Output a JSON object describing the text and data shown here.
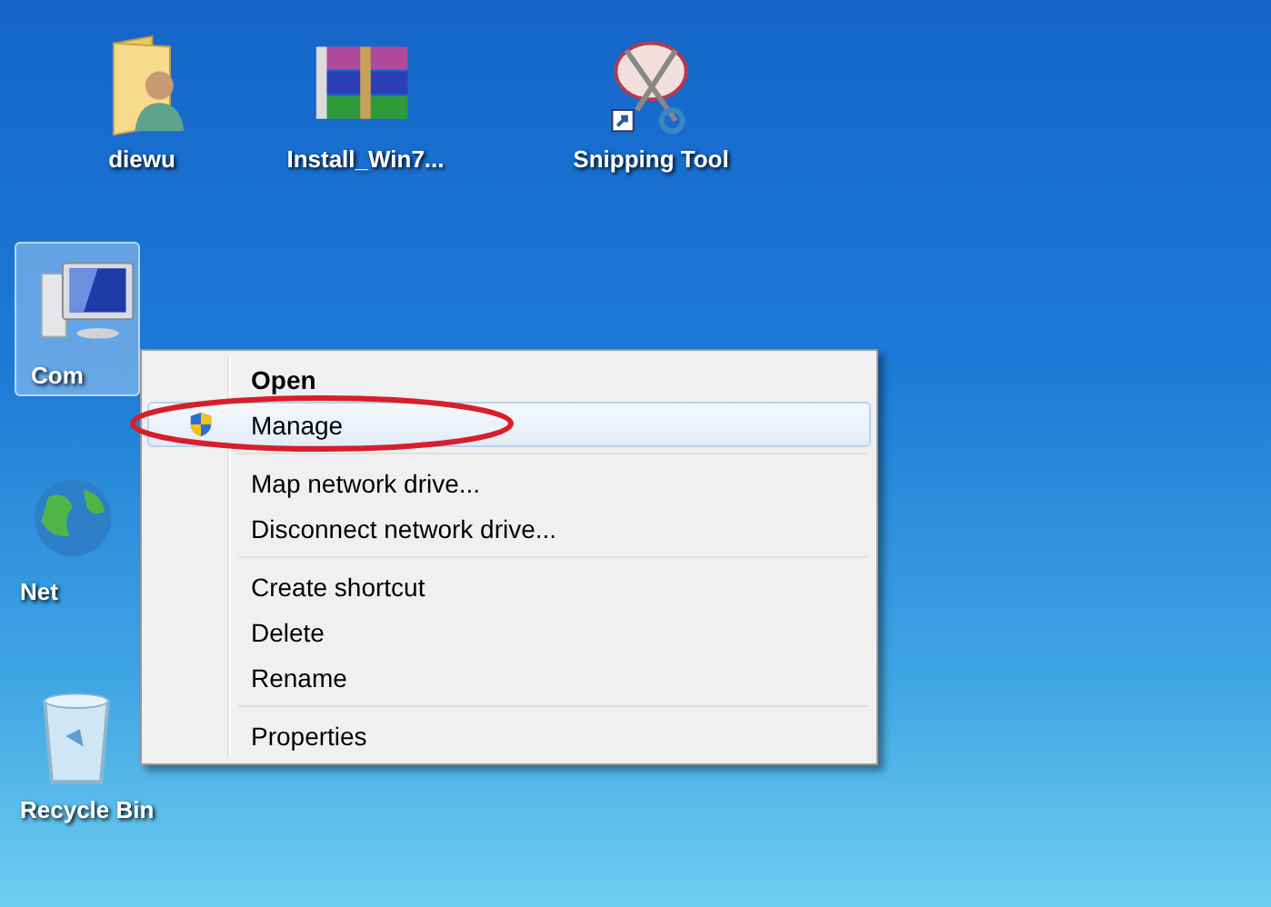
{
  "desktop": {
    "icons": [
      {
        "label": "diewu",
        "kind": "user-folder",
        "selected": false
      },
      {
        "label": "Install_Win7...",
        "kind": "archive",
        "selected": false
      },
      {
        "label": "Snipping Tool",
        "kind": "snipping",
        "selected": false
      },
      {
        "label": "Com",
        "kind": "computer",
        "selected": true
      },
      {
        "label": "Net",
        "kind": "network",
        "selected": false
      },
      {
        "label": "Recycle Bin",
        "kind": "recycle",
        "selected": false
      }
    ]
  },
  "context_menu": {
    "groups": [
      [
        {
          "label": "Open",
          "default": true,
          "shield": false,
          "selected": false
        },
        {
          "label": "Manage",
          "default": false,
          "shield": true,
          "selected": true
        }
      ],
      [
        {
          "label": "Map network drive...",
          "default": false,
          "shield": false,
          "selected": false
        },
        {
          "label": "Disconnect network drive...",
          "default": false,
          "shield": false,
          "selected": false
        }
      ],
      [
        {
          "label": "Create shortcut",
          "default": false,
          "shield": false,
          "selected": false
        },
        {
          "label": "Delete",
          "default": false,
          "shield": false,
          "selected": false
        },
        {
          "label": "Rename",
          "default": false,
          "shield": false,
          "selected": false
        }
      ],
      [
        {
          "label": "Properties",
          "default": false,
          "shield": false,
          "selected": false
        }
      ]
    ]
  }
}
